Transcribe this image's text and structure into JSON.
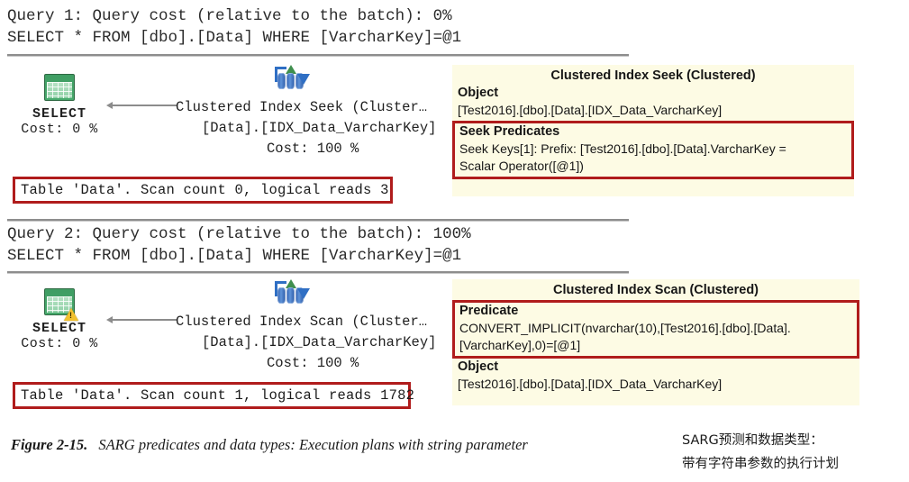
{
  "query1": {
    "header_line1": "Query 1: Query cost (relative to the batch): 0%",
    "header_line2": "SELECT * FROM [dbo].[Data] WHERE [VarcharKey]=@1",
    "select_node": {
      "label": "SELECT",
      "cost": "Cost: 0 %",
      "icon": "select-result-grid-icon",
      "warning": false
    },
    "operator_node": {
      "icon": "clustered-index-seek-icon",
      "line1": "Clustered Index Seek (Cluster…",
      "line2": "[Data].[IDX_Data_VarcharKey]",
      "line3": "Cost: 100 %"
    },
    "stats": "Table 'Data'. Scan count 0, logical reads 3",
    "tooltip": {
      "title": "Clustered Index Seek (Clustered)",
      "object_head": "Object",
      "object_body": "[Test2016].[dbo].[Data].[IDX_Data_VarcharKey]",
      "predicate_head": "Seek Predicates",
      "predicate_line1": "Seek Keys[1]: Prefix: [Test2016].[dbo].[Data].VarcharKey =",
      "predicate_line2": "Scalar Operator([@1])"
    }
  },
  "query2": {
    "header_line1": "Query 2: Query cost (relative to the batch): 100%",
    "header_line2": "SELECT * FROM [dbo].[Data] WHERE [VarcharKey]=@1",
    "select_node": {
      "label": "SELECT",
      "cost": "Cost: 0 %",
      "icon": "select-result-grid-warning-icon",
      "warning": true
    },
    "operator_node": {
      "icon": "clustered-index-scan-icon",
      "line1": "Clustered Index Scan (Cluster…",
      "line2": "[Data].[IDX_Data_VarcharKey]",
      "line3": "Cost: 100 %"
    },
    "stats": "Table 'Data'. Scan count 1, logical reads 1782",
    "tooltip": {
      "title": "Clustered Index Scan (Clustered)",
      "predicate_head": "Predicate",
      "predicate_line1": "CONVERT_IMPLICIT(nvarchar(10),[Test2016].[dbo].[Data].",
      "predicate_line2": "[VarcharKey],0)=[@1]",
      "object_head": "Object",
      "object_body": "[Test2016].[dbo].[Data].[IDX_Data_VarcharKey]"
    }
  },
  "caption": {
    "figure_number": "Figure 2-15.",
    "figure_text": "SARG predicates and data types: Execution plans with string parameter"
  },
  "annotation": {
    "line1": "SARG预测和数据类型：",
    "line2": "带有字符串参数的执行计划"
  },
  "colors": {
    "red_highlight": "#b01c1c",
    "tooltip_bg": "#fdfbe4",
    "rule": "#8d8d8d"
  }
}
